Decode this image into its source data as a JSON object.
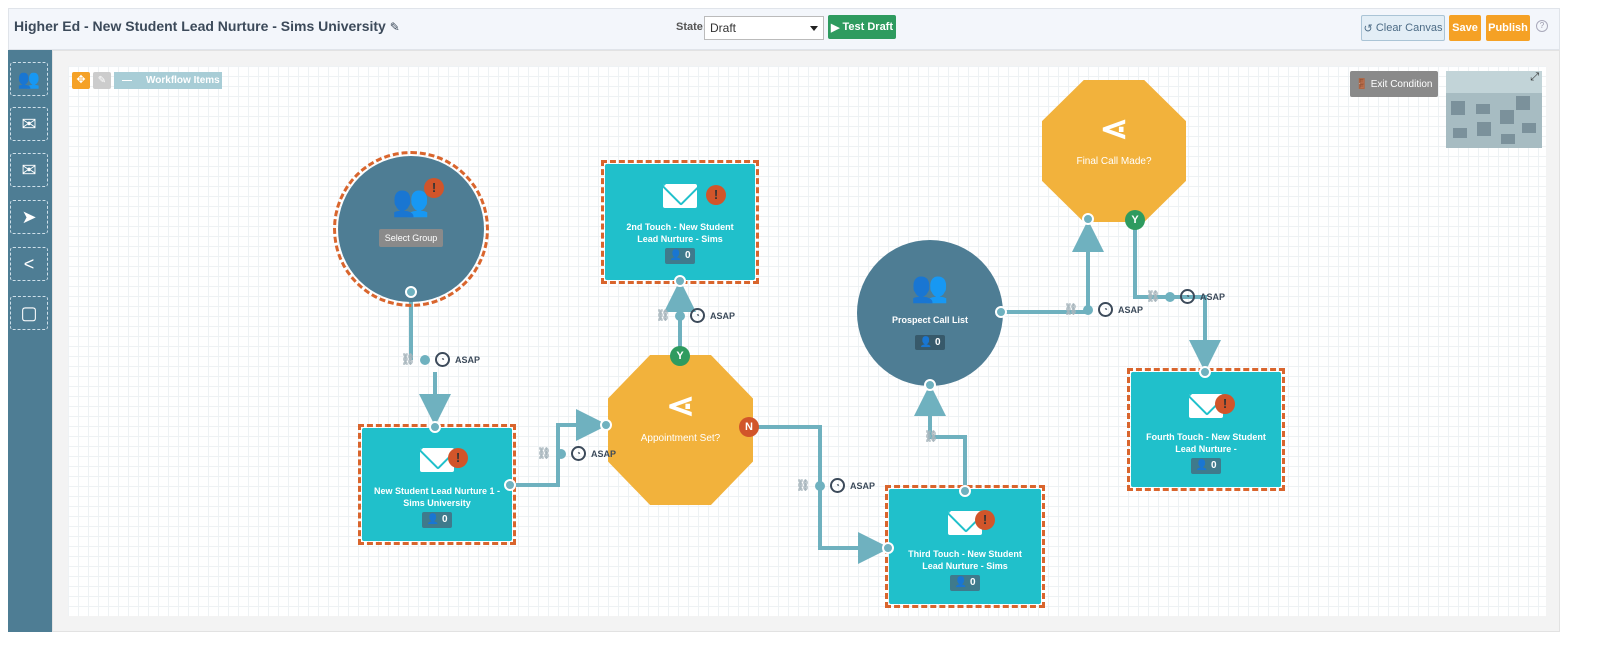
{
  "header": {
    "title": "Higher Ed - New Student Lead Nurture - Sims University",
    "state_label": "State:",
    "state_value": "Draft",
    "test_draft": "Test Draft",
    "clear_canvas": "Clear Canvas",
    "save": "Save",
    "publish": "Publish",
    "help": "?"
  },
  "sidebar": {
    "tools": [
      {
        "icon": "group-icon"
      },
      {
        "icon": "email-icon"
      },
      {
        "icon": "email-opened-icon"
      },
      {
        "icon": "click-icon"
      },
      {
        "icon": "split-icon"
      },
      {
        "icon": "note-icon"
      }
    ]
  },
  "toolbar": {
    "workflow_items": "Workflow Items",
    "exit_condition": "Exit Condition"
  },
  "nodes": {
    "select_group": {
      "label": "Select Group"
    },
    "email1": {
      "label": "New Student Lead Nurture 1 - Sims University",
      "count": "0"
    },
    "email2": {
      "label": "2nd Touch - New Student Lead Nurture - Sims",
      "count": "0"
    },
    "appointment": {
      "label": "Appointment Set?",
      "yes": "Y",
      "no": "N"
    },
    "prospect": {
      "label": "Prospect Call List",
      "count": "0"
    },
    "final_call": {
      "label": "Final Call Made?",
      "yes": "Y"
    },
    "email3": {
      "label": "Third Touch - New Student Lead Nurture - Sims",
      "count": "0"
    },
    "email4": {
      "label": "Fourth Touch - New Student Lead Nurture -",
      "count": "0"
    }
  },
  "delay": "ASAP",
  "colors": {
    "accent": "#f5a125",
    "email": "#20c0cb",
    "group": "#4e7d94",
    "split": "#f2b23c",
    "warning": "#d1552a",
    "connector": "#6fb1bf",
    "yes": "#2e9b5f",
    "no": "#d1552a"
  }
}
